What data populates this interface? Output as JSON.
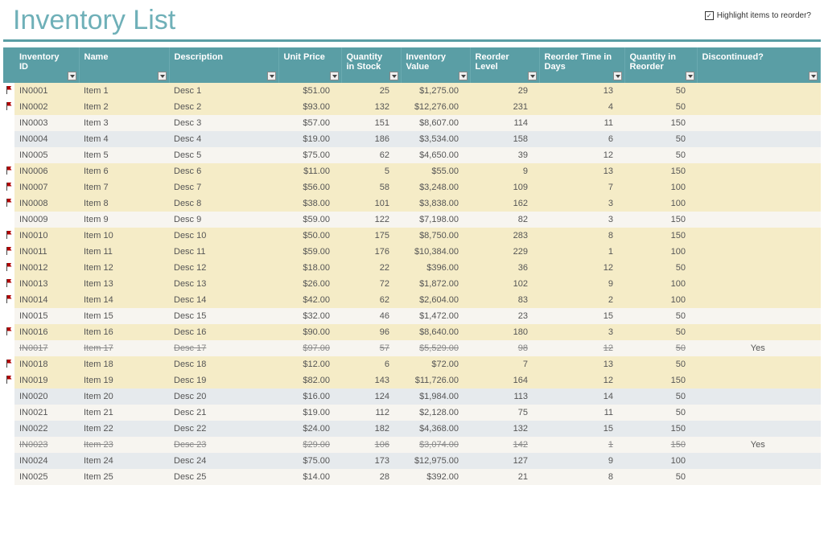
{
  "title": "Inventory List",
  "toggle": {
    "label": "Highlight items to reorder?",
    "checked": true
  },
  "columns": [
    {
      "key": "id",
      "label": "Inventory ID",
      "cls": ""
    },
    {
      "key": "name",
      "label": "Name",
      "cls": ""
    },
    {
      "key": "desc",
      "label": "Description",
      "cls": ""
    },
    {
      "key": "unit",
      "label": "Unit Price",
      "cls": "num"
    },
    {
      "key": "qty",
      "label": "Quantity in Stock",
      "cls": "num"
    },
    {
      "key": "val",
      "label": "Inventory Value",
      "cls": "num"
    },
    {
      "key": "reord",
      "label": "Reorder Level",
      "cls": "num"
    },
    {
      "key": "days",
      "label": "Reorder Time in Days",
      "cls": "num"
    },
    {
      "key": "qtyr",
      "label": "Quantity in Reorder",
      "cls": "num"
    },
    {
      "key": "disc",
      "label": "Discontinued?",
      "cls": "center disc-cell"
    }
  ],
  "rows": [
    {
      "flag": true,
      "hl": true,
      "id": "IN0001",
      "name": "Item 1",
      "desc": "Desc 1",
      "unit": "$51.00",
      "qty": "25",
      "val": "$1,275.00",
      "reord": "29",
      "days": "13",
      "qtyr": "50",
      "disc": ""
    },
    {
      "flag": true,
      "hl": true,
      "id": "IN0002",
      "name": "Item 2",
      "desc": "Desc 2",
      "unit": "$93.00",
      "qty": "132",
      "val": "$12,276.00",
      "reord": "231",
      "days": "4",
      "qtyr": "50",
      "disc": ""
    },
    {
      "flag": false,
      "hl": false,
      "id": "IN0003",
      "name": "Item 3",
      "desc": "Desc 3",
      "unit": "$57.00",
      "qty": "151",
      "val": "$8,607.00",
      "reord": "114",
      "days": "11",
      "qtyr": "150",
      "disc": ""
    },
    {
      "flag": false,
      "hl": false,
      "id": "IN0004",
      "name": "Item 4",
      "desc": "Desc 4",
      "unit": "$19.00",
      "qty": "186",
      "val": "$3,534.00",
      "reord": "158",
      "days": "6",
      "qtyr": "50",
      "disc": ""
    },
    {
      "flag": false,
      "hl": false,
      "id": "IN0005",
      "name": "Item 5",
      "desc": "Desc 5",
      "unit": "$75.00",
      "qty": "62",
      "val": "$4,650.00",
      "reord": "39",
      "days": "12",
      "qtyr": "50",
      "disc": ""
    },
    {
      "flag": true,
      "hl": true,
      "id": "IN0006",
      "name": "Item 6",
      "desc": "Desc 6",
      "unit": "$11.00",
      "qty": "5",
      "val": "$55.00",
      "reord": "9",
      "days": "13",
      "qtyr": "150",
      "disc": ""
    },
    {
      "flag": true,
      "hl": true,
      "id": "IN0007",
      "name": "Item 7",
      "desc": "Desc 7",
      "unit": "$56.00",
      "qty": "58",
      "val": "$3,248.00",
      "reord": "109",
      "days": "7",
      "qtyr": "100",
      "disc": ""
    },
    {
      "flag": true,
      "hl": true,
      "id": "IN0008",
      "name": "Item 8",
      "desc": "Desc 8",
      "unit": "$38.00",
      "qty": "101",
      "val": "$3,838.00",
      "reord": "162",
      "days": "3",
      "qtyr": "100",
      "disc": ""
    },
    {
      "flag": false,
      "hl": false,
      "id": "IN0009",
      "name": "Item 9",
      "desc": "Desc 9",
      "unit": "$59.00",
      "qty": "122",
      "val": "$7,198.00",
      "reord": "82",
      "days": "3",
      "qtyr": "150",
      "disc": ""
    },
    {
      "flag": true,
      "hl": true,
      "id": "IN0010",
      "name": "Item 10",
      "desc": "Desc 10",
      "unit": "$50.00",
      "qty": "175",
      "val": "$8,750.00",
      "reord": "283",
      "days": "8",
      "qtyr": "150",
      "disc": ""
    },
    {
      "flag": true,
      "hl": true,
      "id": "IN0011",
      "name": "Item 11",
      "desc": "Desc 11",
      "unit": "$59.00",
      "qty": "176",
      "val": "$10,384.00",
      "reord": "229",
      "days": "1",
      "qtyr": "100",
      "disc": ""
    },
    {
      "flag": true,
      "hl": true,
      "id": "IN0012",
      "name": "Item 12",
      "desc": "Desc 12",
      "unit": "$18.00",
      "qty": "22",
      "val": "$396.00",
      "reord": "36",
      "days": "12",
      "qtyr": "50",
      "disc": ""
    },
    {
      "flag": true,
      "hl": true,
      "id": "IN0013",
      "name": "Item 13",
      "desc": "Desc 13",
      "unit": "$26.00",
      "qty": "72",
      "val": "$1,872.00",
      "reord": "102",
      "days": "9",
      "qtyr": "100",
      "disc": ""
    },
    {
      "flag": true,
      "hl": true,
      "id": "IN0014",
      "name": "Item 14",
      "desc": "Desc 14",
      "unit": "$42.00",
      "qty": "62",
      "val": "$2,604.00",
      "reord": "83",
      "days": "2",
      "qtyr": "100",
      "disc": ""
    },
    {
      "flag": false,
      "hl": false,
      "id": "IN0015",
      "name": "Item 15",
      "desc": "Desc 15",
      "unit": "$32.00",
      "qty": "46",
      "val": "$1,472.00",
      "reord": "23",
      "days": "15",
      "qtyr": "50",
      "disc": ""
    },
    {
      "flag": true,
      "hl": true,
      "id": "IN0016",
      "name": "Item 16",
      "desc": "Desc 16",
      "unit": "$90.00",
      "qty": "96",
      "val": "$8,640.00",
      "reord": "180",
      "days": "3",
      "qtyr": "50",
      "disc": ""
    },
    {
      "flag": false,
      "hl": false,
      "discontinued": true,
      "id": "IN0017",
      "name": "Item 17",
      "desc": "Desc 17",
      "unit": "$97.00",
      "qty": "57",
      "val": "$5,529.00",
      "reord": "98",
      "days": "12",
      "qtyr": "50",
      "disc": "Yes"
    },
    {
      "flag": true,
      "hl": true,
      "id": "IN0018",
      "name": "Item 18",
      "desc": "Desc 18",
      "unit": "$12.00",
      "qty": "6",
      "val": "$72.00",
      "reord": "7",
      "days": "13",
      "qtyr": "50",
      "disc": ""
    },
    {
      "flag": true,
      "hl": true,
      "id": "IN0019",
      "name": "Item 19",
      "desc": "Desc 19",
      "unit": "$82.00",
      "qty": "143",
      "val": "$11,726.00",
      "reord": "164",
      "days": "12",
      "qtyr": "150",
      "disc": ""
    },
    {
      "flag": false,
      "hl": false,
      "id": "IN0020",
      "name": "Item 20",
      "desc": "Desc 20",
      "unit": "$16.00",
      "qty": "124",
      "val": "$1,984.00",
      "reord": "113",
      "days": "14",
      "qtyr": "50",
      "disc": ""
    },
    {
      "flag": false,
      "hl": false,
      "id": "IN0021",
      "name": "Item 21",
      "desc": "Desc 21",
      "unit": "$19.00",
      "qty": "112",
      "val": "$2,128.00",
      "reord": "75",
      "days": "11",
      "qtyr": "50",
      "disc": ""
    },
    {
      "flag": false,
      "hl": false,
      "id": "IN0022",
      "name": "Item 22",
      "desc": "Desc 22",
      "unit": "$24.00",
      "qty": "182",
      "val": "$4,368.00",
      "reord": "132",
      "days": "15",
      "qtyr": "150",
      "disc": ""
    },
    {
      "flag": false,
      "hl": false,
      "discontinued": true,
      "id": "IN0023",
      "name": "Item 23",
      "desc": "Desc 23",
      "unit": "$29.00",
      "qty": "106",
      "val": "$3,074.00",
      "reord": "142",
      "days": "1",
      "qtyr": "150",
      "disc": "Yes"
    },
    {
      "flag": false,
      "hl": false,
      "id": "IN0024",
      "name": "Item 24",
      "desc": "Desc 24",
      "unit": "$75.00",
      "qty": "173",
      "val": "$12,975.00",
      "reord": "127",
      "days": "9",
      "qtyr": "100",
      "disc": ""
    },
    {
      "flag": false,
      "hl": false,
      "id": "IN0025",
      "name": "Item 25",
      "desc": "Desc 25",
      "unit": "$14.00",
      "qty": "28",
      "val": "$392.00",
      "reord": "21",
      "days": "8",
      "qtyr": "50",
      "disc": ""
    }
  ]
}
